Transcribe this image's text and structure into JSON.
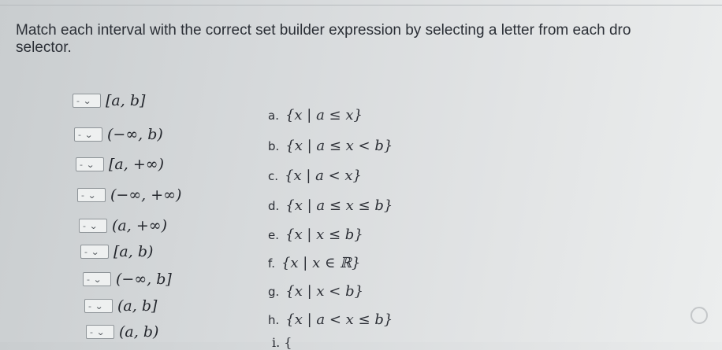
{
  "instruction": "Match each interval with the correct set builder expression by selecting a letter from each dro",
  "instruction_line2": "selector.",
  "dropdown_value": "-",
  "dropdown_icon": "chevron-down-icon",
  "intervals": [
    "[a, b]",
    "(−∞, b)",
    "[a, +∞)",
    "(−∞, +∞)",
    "(a, +∞)",
    "[a, b)",
    "(−∞, b]",
    "(a, b]",
    "(a, b)"
  ],
  "options": [
    {
      "letter": "a.",
      "expr": "{x | a ≤ x}"
    },
    {
      "letter": "b.",
      "expr": "{x | a ≤ x < b}"
    },
    {
      "letter": "c.",
      "expr": "{x | a < x}"
    },
    {
      "letter": "d.",
      "expr": "{x | a ≤ x ≤ b}"
    },
    {
      "letter": "e.",
      "expr": "{x | x ≤ b}"
    },
    {
      "letter": "f.",
      "expr": "{x | x ∈ ℝ}"
    },
    {
      "letter": "g.",
      "expr": "{x | x < b}"
    },
    {
      "letter": "h.",
      "expr": "{x | a < x ≤ b}"
    }
  ],
  "partial_option": "i. {"
}
